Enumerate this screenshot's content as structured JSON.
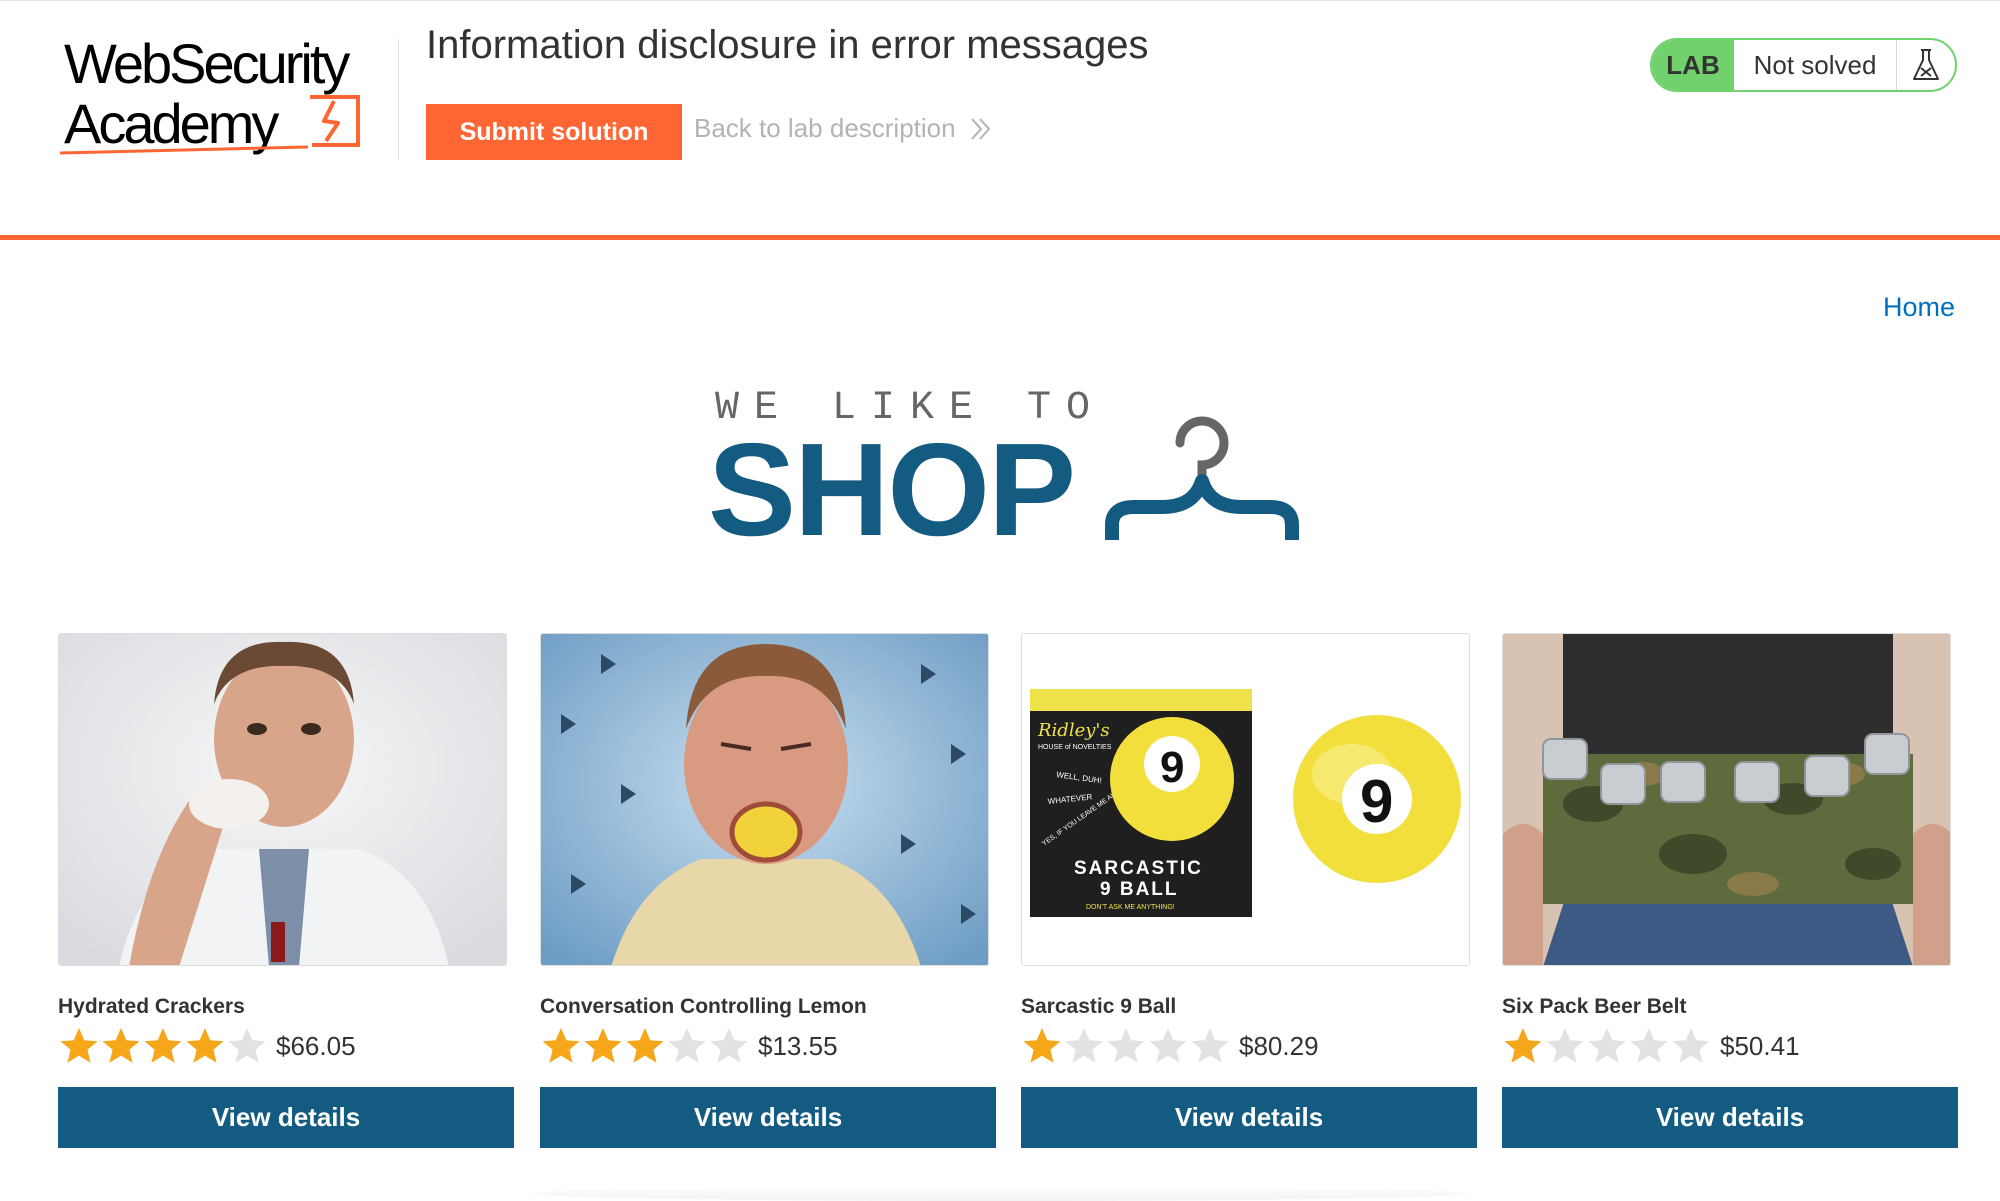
{
  "lab": {
    "logo_line1": "WebSecurity",
    "logo_line2": "Academy",
    "title": "Information disclosure in error messages",
    "submit_label": "Submit solution",
    "back_label": "Back to lab description",
    "badge": "LAB",
    "status": "Not solved",
    "accent_color": "#ff6633",
    "status_color": "#70d16d"
  },
  "nav": {
    "home": "Home"
  },
  "banner": {
    "small": "WE LIKE TO",
    "big": "SHOP",
    "color": "#145b82"
  },
  "products": [
    {
      "name": "Hydrated Crackers",
      "rating": 4,
      "max_rating": 5,
      "price": "$66.05",
      "button": "View details"
    },
    {
      "name": "Conversation Controlling Lemon",
      "rating": 3,
      "max_rating": 5,
      "price": "$13.55",
      "button": "View details"
    },
    {
      "name": "Sarcastic 9 Ball",
      "rating": 1,
      "max_rating": 5,
      "price": "$80.29",
      "button": "View details"
    },
    {
      "name": "Six Pack Beer Belt",
      "rating": 1,
      "max_rating": 5,
      "price": "$50.41",
      "button": "View details"
    }
  ],
  "product_images": {
    "ball_box_brand": "Ridley's",
    "ball_box_tagline": "HOUSE of NOVELTIES",
    "ball_box_lines": [
      "WELL, DUH!",
      "WHATEVER",
      "YES, IF YOU LEAVE ME ALONE"
    ],
    "ball_box_title1": "SARCASTIC",
    "ball_box_title2": "9 BALL",
    "ball_box_footer": "DON'T ASK ME ANYTHING!",
    "ball_number": "9"
  },
  "colors": {
    "star_filled": "#f6a619",
    "star_empty": "#e2e2e2",
    "button": "#145b82",
    "link": "#0071bc"
  }
}
